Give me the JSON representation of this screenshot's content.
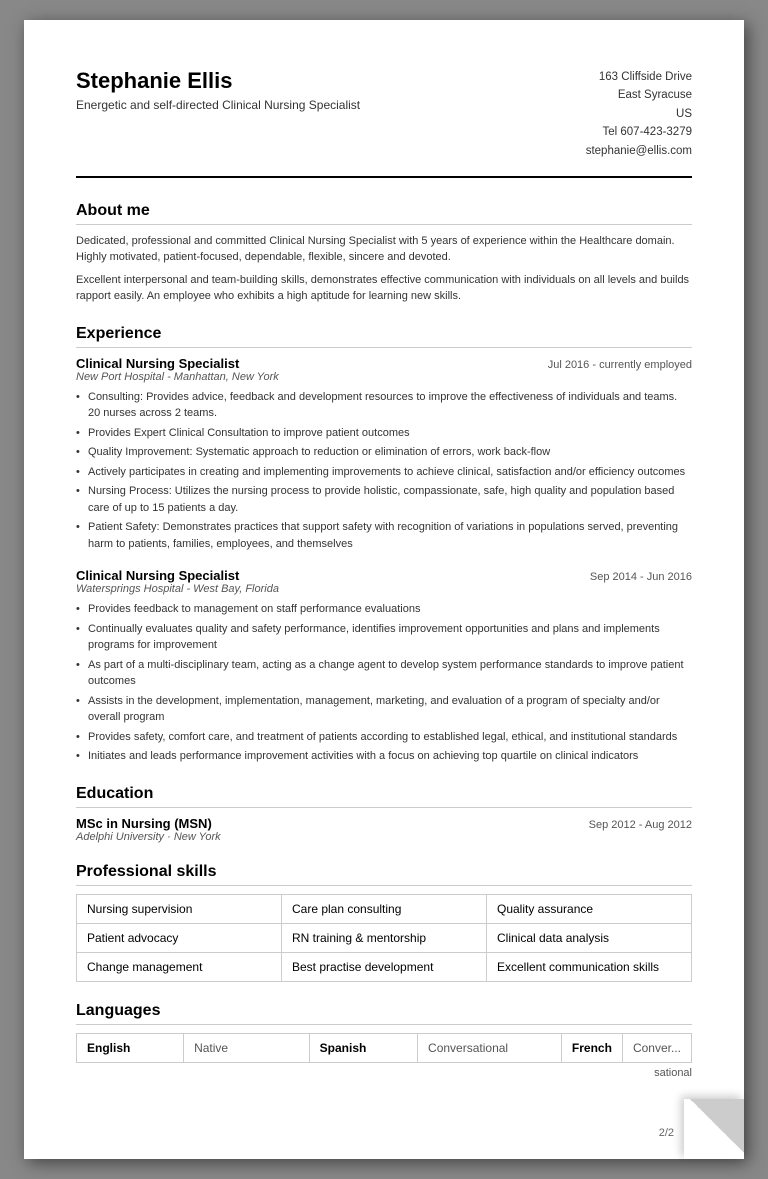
{
  "header": {
    "name": "Stephanie Ellis",
    "subtitle": "Energetic and self-directed Clinical Nursing Specialist",
    "address_line1": "163 Cliffside Drive",
    "address_line2": "East Syracuse",
    "address_line3": "US",
    "phone": "Tel 607-423-3279",
    "email": "stephanie@ellis.com"
  },
  "about": {
    "title": "About me",
    "para1": "Dedicated, professional and committed Clinical Nursing Specialist with 5 years of experience within the Healthcare domain. Highly motivated, patient-focused, dependable, flexible, sincere and devoted.",
    "para2": "Excellent interpersonal and team-building skills, demonstrates effective communication with individuals on all levels and builds rapport easily. An employee who exhibits a high aptitude for learning new skills."
  },
  "experience": {
    "title": "Experience",
    "jobs": [
      {
        "title": "Clinical Nursing Specialist",
        "dates": "Jul 2016 - currently employed",
        "company": "New Port Hospital - Manhattan, New York",
        "bullets": [
          "Consulting: Provides advice, feedback and development resources to improve the effectiveness of individuals and teams. 20 nurses across 2 teams.",
          "Provides Expert Clinical Consultation to improve patient outcomes",
          "Quality Improvement: Systematic approach to reduction or elimination of errors, work back-flow",
          "Actively participates in creating and implementing improvements to achieve clinical, satisfaction and/or efficiency outcomes",
          "Nursing Process: Utilizes the nursing process to provide holistic, compassionate, safe, high quality and population based care of up to 15 patients a day.",
          "Patient Safety: Demonstrates practices that support safety with recognition of variations in populations served, preventing harm to patients, families, employees, and themselves"
        ]
      },
      {
        "title": "Clinical Nursing Specialist",
        "dates": "Sep 2014 - Jun 2016",
        "company": "Watersprings Hospital - West Bay, Florida",
        "bullets": [
          "Provides feedback to management on staff performance evaluations",
          "Continually evaluates quality and safety performance, identifies improvement opportunities and plans and implements programs for improvement",
          "As part of a multi-disciplinary team, acting as a change agent to develop system performance standards to improve patient outcomes",
          "Assists in the development, implementation, management, marketing, and evaluation of a program of specialty and/or overall program",
          "Provides safety, comfort care, and treatment of patients according to established legal, ethical, and institutional standards",
          "Initiates and leads performance improvement activities with a focus on achieving top quartile on clinical indicators"
        ]
      }
    ]
  },
  "education": {
    "title": "Education",
    "degree": "MSc in Nursing (MSN)",
    "dates": "Sep 2012 - Aug 2012",
    "institution": "Adelphi University · New York"
  },
  "skills": {
    "title": "Professional skills",
    "rows": [
      [
        "Nursing supervision",
        "Care plan consulting",
        "Quality assurance"
      ],
      [
        "Patient advocacy",
        "RN training & mentorship",
        "Clinical data analysis"
      ],
      [
        "Change management",
        "Best practise development",
        "Excellent communication skills"
      ]
    ]
  },
  "languages": {
    "title": "Languages",
    "entries": [
      {
        "name": "English",
        "level": "Native"
      },
      {
        "name": "Spanish",
        "level": "Conversational"
      },
      {
        "name": "French",
        "level": "Conver..."
      }
    ],
    "extra_level": "sational"
  },
  "page_number": "2/2"
}
